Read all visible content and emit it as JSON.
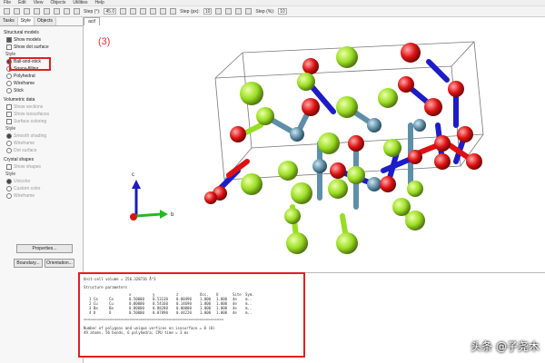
{
  "menu": [
    "File",
    "Edit",
    "View",
    "Objects",
    "Utilities",
    "Help"
  ],
  "toolbar": {
    "step1_label": "Step (°):",
    "step1_value": "45.0",
    "step2_label": "Step (px):",
    "step2_value": "10",
    "step3_label": "Step (%):",
    "step3_value": "10"
  },
  "tabs": [
    "Tasks",
    "Style",
    "Objects"
  ],
  "structural": {
    "heading": "Structural models",
    "show_models": "Show models",
    "show_dot_surface": "Show dot surface",
    "style_label": "Style",
    "options": [
      "Ball-and-stick",
      "Space-filling",
      "Polyhedral",
      "Wireframe",
      "Stick"
    ]
  },
  "volumetric": {
    "heading": "Volumetric data",
    "show_sections": "Show sections",
    "show_isosurfaces": "Show isosurfaces",
    "surface_coloring": "Surface coloring",
    "style_label": "Style",
    "options": [
      "Smooth shading",
      "Wireframe",
      "Dot surface"
    ]
  },
  "crystal": {
    "heading": "Crystal shapes",
    "show_shapes": "Show shapes",
    "style_label": "Style",
    "options": [
      "Unicolor",
      "Custom color",
      "Wireframe"
    ]
  },
  "buttons": {
    "properties": "Properties...",
    "boundary": "Boundary...",
    "orientation": "Orientation..."
  },
  "viewer": {
    "tab": "acif",
    "annotation": "(3)",
    "axis_c": "c",
    "axis_b": "b"
  },
  "output": {
    "volume_line": "Unit-cell volume = 256.328716 Å^3",
    "params_heading": "Structure parameters",
    "columns": [
      "",
      "",
      "x",
      "y",
      "z",
      "Occ.",
      "U",
      "Site",
      "Sym."
    ],
    "rows": [
      [
        "1 Ca",
        "Ca",
        "0.50000",
        "0.53130",
        "0.00490",
        "1.000",
        "1.000",
        "4e",
        "m.."
      ],
      [
        "2 Cu",
        "Cu",
        "0.00000",
        "0.54160",
        "0.14690",
        "1.000",
        "1.000",
        "4e",
        "m.."
      ],
      [
        "3 Ba",
        "Ba",
        "0.00000",
        "0.88280",
        "0.00000",
        "1.000",
        "1.000",
        "4e",
        "m.."
      ],
      [
        "4 O",
        "O",
        "0.50000",
        "0.07890",
        "0.44220",
        "1.000",
        "1.000",
        "4e",
        "m.."
      ]
    ],
    "summary1": "Number of polygons and unique vertices on isosurface = 0 (0)",
    "summary2": "49 atoms, 56 bonds, 6 polyhedra; CPU time = 3 ms"
  },
  "watermark": "头条 @子尧木",
  "colors": {
    "highlight": "#e02020",
    "bond_blue": "#1c1cc8",
    "oxygen": "#dd1111",
    "green_atom": "#99dd22",
    "metal": "#5f8fa8"
  }
}
